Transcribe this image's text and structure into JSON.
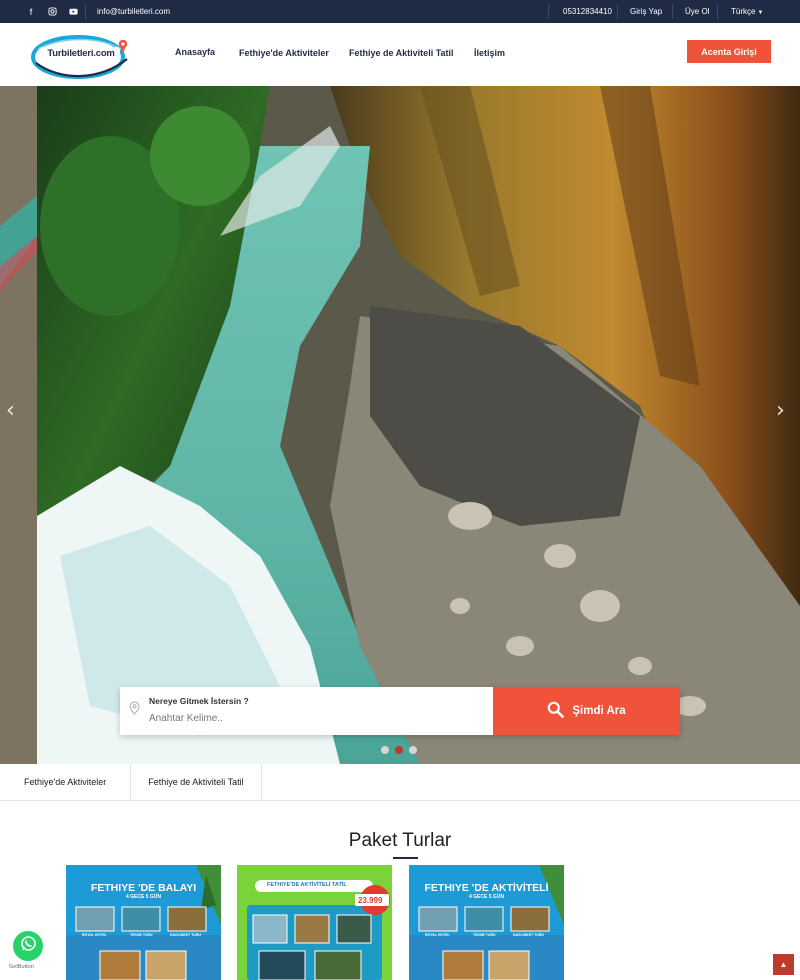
{
  "topbar": {
    "email": "info@turbiletleri.com",
    "phone": "05312834410",
    "login": "Giriş Yap",
    "register": "Üye Ol",
    "language": "Türkçe"
  },
  "header": {
    "logo_text": "Turbiletleri.com",
    "nav": [
      "Anasayfa",
      "Fethiye'de Aktiviteler",
      "Fethiye de Aktiviteli Tatil",
      "İletişim"
    ],
    "agent_button": "Acenta Girişi"
  },
  "search": {
    "label": "Nereye Gitmek İstersin ?",
    "placeholder": "Anahtar Kelime..",
    "button": "Şimdi Ara"
  },
  "slider": {
    "slides": 3,
    "active": 2
  },
  "categories": [
    "Fethiye'de Aktiviteler",
    "Fethiye de Aktiviteli Tatil"
  ],
  "section": {
    "title": "Paket Turlar"
  },
  "cards": [
    {
      "title": "FETHIYE 'DE BALAYI",
      "subtitle": "4 GECE 5 GÜN",
      "labels": [
        "ROYAL HOTEL",
        "TEKNE TURU",
        "DAGLINEST TURU"
      ]
    },
    {
      "title": "FETHIYE'DE AKTİVİTELİ TATİL",
      "price": "23.999"
    },
    {
      "title": "FETHIYE 'DE AKTİVİTELİ",
      "subtitle": "4 GECE 5 GÜN",
      "labels": [
        "ROYAL HOTEL",
        "TEKNE TURU",
        "DAGLINEST TURU"
      ]
    }
  ],
  "floating": {
    "getbutton": "GetButton"
  },
  "colors": {
    "navy": "#1f2a44",
    "accent": "#f0533a",
    "active_dot": "#c0392b"
  }
}
